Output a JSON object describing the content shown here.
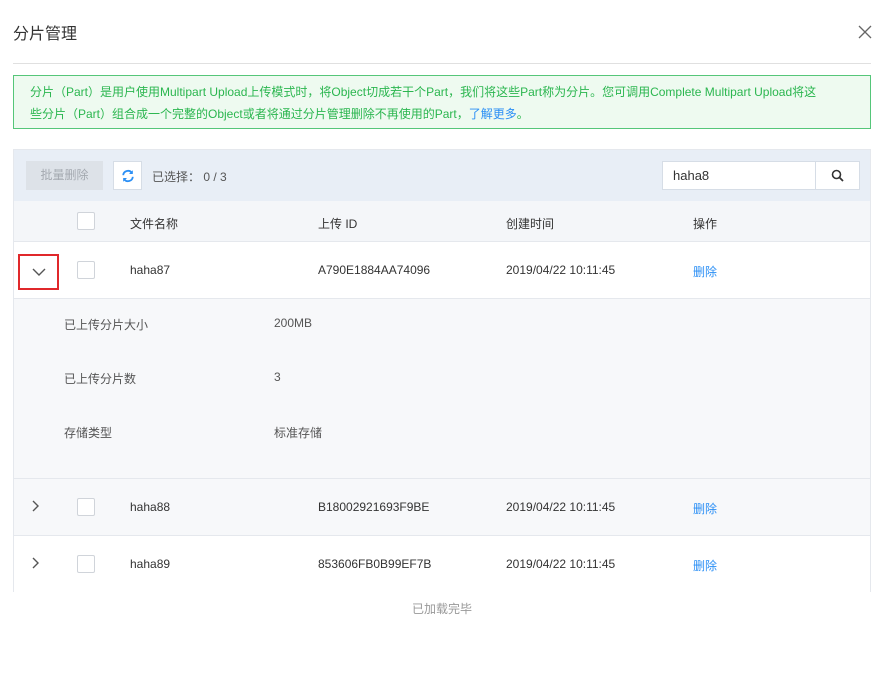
{
  "dialog": {
    "title": "分片管理"
  },
  "notice": {
    "line1": "分片（Part）是用户使用Multipart Upload上传模式时，将Object切成若干个Part，我们将这些Part称为分片。您可调用Complete Multipart Upload将这",
    "line2": "些分片（Part）组合成一个完整的Object或者将通过分片管理删除不再使用的Part，",
    "link": "了解更多",
    "end": "。"
  },
  "toolbar": {
    "batch_delete": "批量删除",
    "selected_label": "已选择：",
    "selected_count": "0 / 3",
    "search_value": "haha8"
  },
  "table": {
    "headers": {
      "name": "文件名称",
      "upload_id": "上传 ID",
      "created": "创建时间",
      "action": "操作"
    },
    "rows": [
      {
        "name": "haha87",
        "upload_id": "A790E1884AA74096",
        "created": "2019/04/22 10:11:45",
        "action": "删除",
        "expanded": true
      },
      {
        "name": "haha88",
        "upload_id": "B18002921693F9BE",
        "created": "2019/04/22 10:11:45",
        "action": "删除",
        "expanded": false
      },
      {
        "name": "haha89",
        "upload_id": "853606FB0B99EF7B",
        "created": "2019/04/22 10:11:45",
        "action": "删除",
        "expanded": false
      }
    ],
    "detail": {
      "size_label": "已上传分片大小",
      "size_value": "200MB",
      "count_label": "已上传分片数",
      "count_value": "3",
      "storage_label": "存储类型",
      "storage_value": "标准存储"
    }
  },
  "footer": {
    "loaded": "已加载完毕"
  },
  "colors": {
    "accent_blue": "#2b8ff5",
    "notice_green": "#2bb64f",
    "highlight_red": "#e0282b"
  },
  "icons": {
    "close": "close-icon",
    "refresh": "refresh-icon",
    "search": "search-icon",
    "expand": "chevron-icon"
  }
}
